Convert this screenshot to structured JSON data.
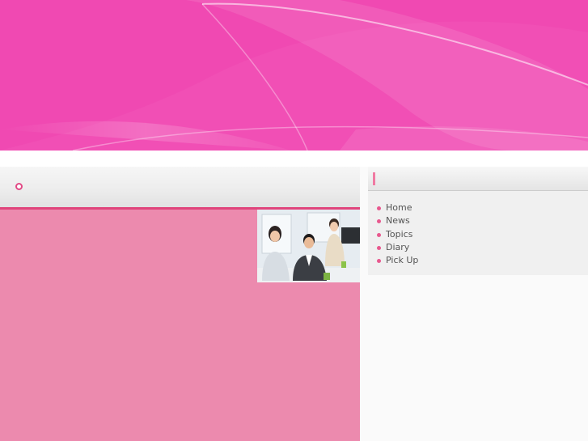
{
  "main": {
    "title": ""
  },
  "sidebar": {
    "title": "",
    "items": [
      {
        "label": "Home"
      },
      {
        "label": "News"
      },
      {
        "label": "Topics"
      },
      {
        "label": "Diary"
      },
      {
        "label": "Pick Up"
      }
    ]
  },
  "colors": {
    "banner": "#f04ab2",
    "accent": "#e0457c",
    "content_bg": "#ec8aae",
    "bullet": "#e8588e"
  }
}
